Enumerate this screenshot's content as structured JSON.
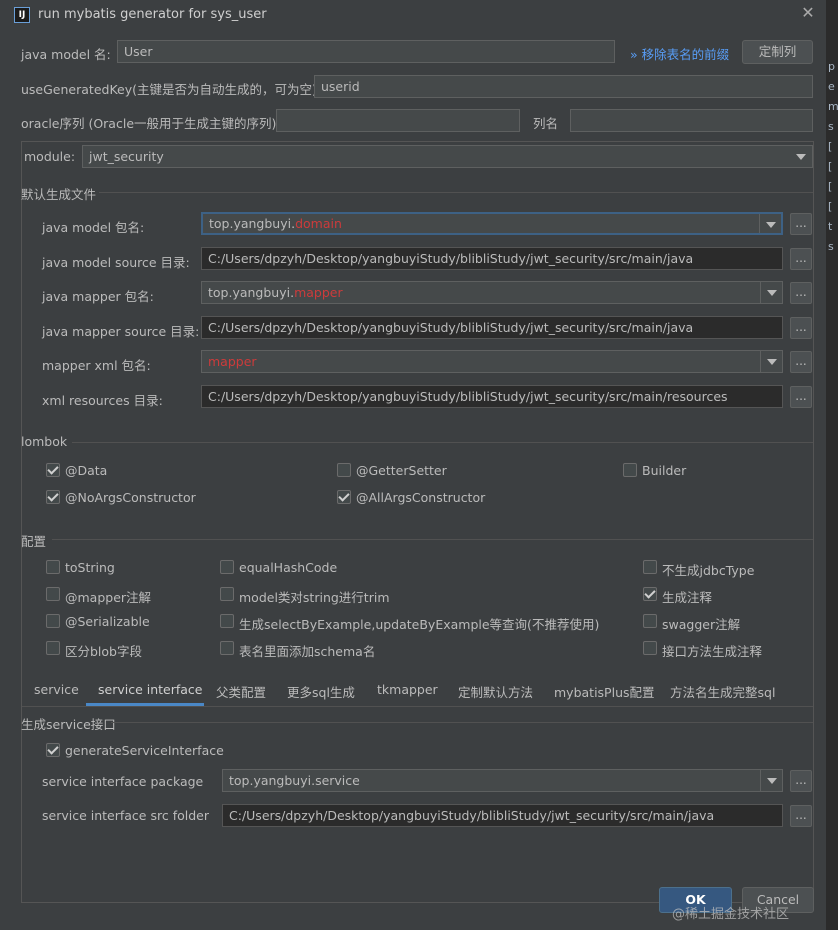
{
  "window": {
    "title": "run mybatis generator for sys_user",
    "logo_text": "IJ",
    "close": "✕"
  },
  "top": {
    "java_model_label": "java model 名:",
    "java_model_value": "User",
    "remove_prefix_link": "移除表名的前缀",
    "remove_prefix_arrows": "»",
    "custom_columns_button": "定制列",
    "use_generated_key_label": "useGeneratedKey(主键是否为自动生成的，可为空):",
    "use_generated_key_value": "userid",
    "oracle_seq_label": "oracle序列 (Oracle一般用于生成主键的序列)",
    "oracle_seq_value": "",
    "column_name_label": "列名",
    "column_name_value": ""
  },
  "module": {
    "label": "module:",
    "value": "jwt_security"
  },
  "default_files": {
    "section_title": "默认生成文件",
    "rows": [
      {
        "label": "java model 包名:",
        "prefix": "top.yangbuyi.",
        "suffix": "domain",
        "combo": true
      },
      {
        "label": "java model source 目录:",
        "prefix": "C:/Users/dpzyh/Desktop/yangbuyiStudy/blibliStudy/jwt_security/src/main/java",
        "suffix": "",
        "combo": false
      },
      {
        "label": "java mapper 包名:",
        "prefix": "top.yangbuyi.",
        "suffix": "mapper",
        "combo": true
      },
      {
        "label": "java mapper source 目录:",
        "prefix": "C:/Users/dpzyh/Desktop/yangbuyiStudy/blibliStudy/jwt_security/src/main/java",
        "suffix": "",
        "combo": false
      },
      {
        "label": "mapper xml 包名:",
        "prefix": "",
        "suffix": "mapper",
        "combo": true
      },
      {
        "label": "xml resources 目录:",
        "prefix": "C:/Users/dpzyh/Desktop/yangbuyiStudy/blibliStudy/jwt_security/src/main/resources",
        "suffix": "",
        "combo": false
      }
    ],
    "browse_label": "..."
  },
  "lombok": {
    "section_title": "lombok",
    "options": [
      {
        "label": "@Data",
        "checked": true
      },
      {
        "label": "@GetterSetter",
        "checked": false
      },
      {
        "label": "Builder",
        "checked": false
      },
      {
        "label": "@NoArgsConstructor",
        "checked": true
      },
      {
        "label": "@AllArgsConstructor",
        "checked": true
      }
    ]
  },
  "config": {
    "section_title": "配置",
    "options": [
      {
        "label": "toString",
        "checked": false
      },
      {
        "label": "equalHashCode",
        "checked": false
      },
      {
        "label": "不生成jdbcType",
        "checked": false
      },
      {
        "label": "@mapper注解",
        "checked": false
      },
      {
        "label": "model类对string进行trim",
        "checked": false
      },
      {
        "label": "生成注释",
        "checked": true
      },
      {
        "label": "@Serializable",
        "checked": false
      },
      {
        "label": "生成selectByExample,updateByExample等查询(不推荐使用)",
        "checked": false
      },
      {
        "label": "swagger注解",
        "checked": false
      },
      {
        "label": "区分blob字段",
        "checked": false
      },
      {
        "label": "表名里面添加schema名",
        "checked": false
      },
      {
        "label": "接口方法生成注释",
        "checked": false
      }
    ]
  },
  "tabs": [
    {
      "label": "service",
      "active": false
    },
    {
      "label": "service interface",
      "active": true
    },
    {
      "label": "父类配置",
      "active": false
    },
    {
      "label": "更多sql生成",
      "active": false
    },
    {
      "label": "tkmapper",
      "active": false
    },
    {
      "label": "定制默认方法",
      "active": false
    },
    {
      "label": "mybatisPlus配置",
      "active": false
    },
    {
      "label": "方法名生成完整sql",
      "active": false
    }
  ],
  "service_interface": {
    "section_title": "生成service接口",
    "generate_label": "generateServiceInterface",
    "generate_checked": true,
    "package_label": "service interface package",
    "package_value": "top.yangbuyi.service",
    "src_label": "service interface src folder",
    "src_value": "C:/Users/dpzyh/Desktop/yangbuyiStudy/blibliStudy/jwt_security/src/main/java"
  },
  "footer": {
    "ok": "OK",
    "cancel": "Cancel"
  },
  "watermark": "@稀土掘金技术社区",
  "side_strip_chars": [
    "p",
    "e",
    "m",
    "s",
    "[",
    "[",
    "[",
    "[",
    "t",
    "s"
  ],
  "colors": {
    "accent": "#4a88c7",
    "highlight_red": "#cc3b3b",
    "link": "#589df6",
    "primary_button": "#365880"
  }
}
